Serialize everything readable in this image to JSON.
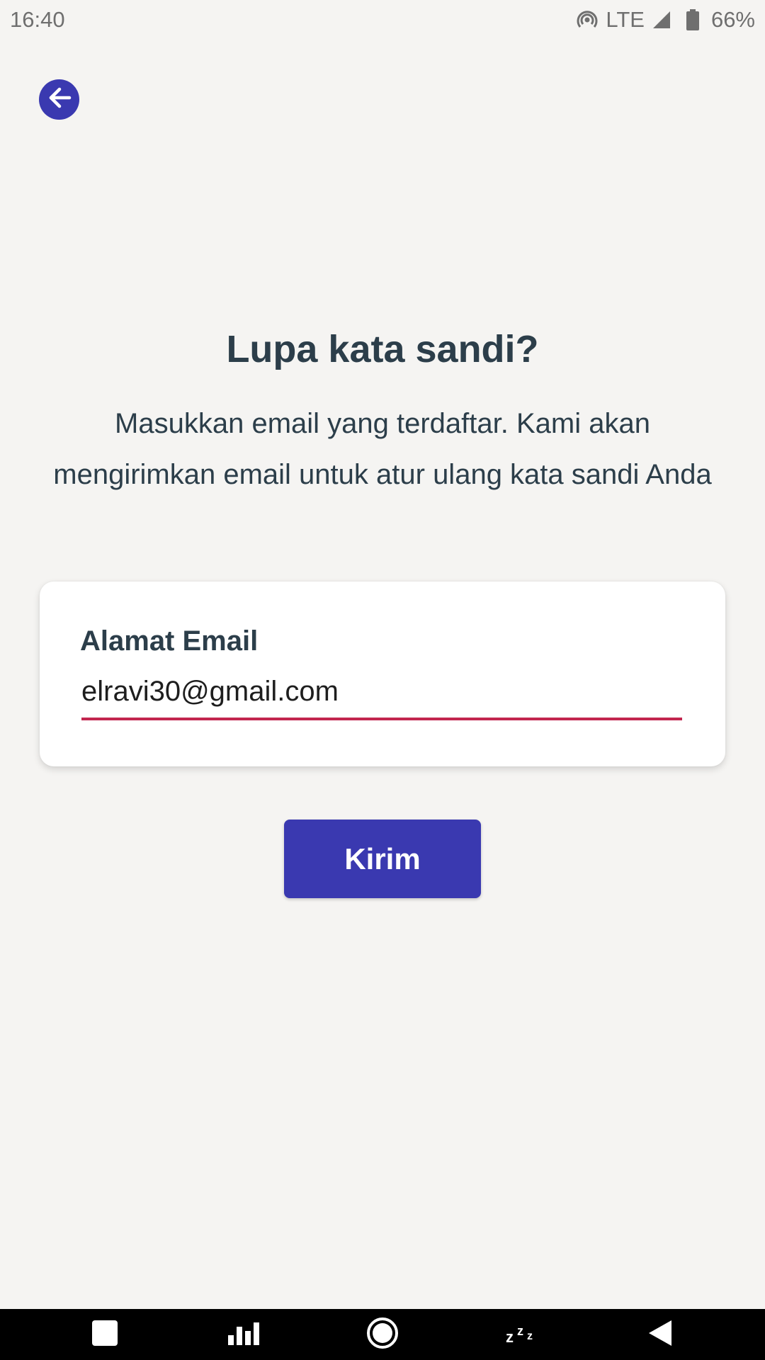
{
  "status_bar": {
    "time": "16:40",
    "network": "LTE",
    "battery": "66%",
    "icons": [
      "hotspot-icon",
      "signal-icon",
      "battery-icon"
    ]
  },
  "header": {
    "back_icon": "arrow-left-icon"
  },
  "main": {
    "title": "Lupa kata sandi?",
    "subtitle": "Masukkan email yang terdaftar. Kami akan mengirimkan email untuk atur ulang kata sandi Anda",
    "email_label": "Alamat Email",
    "email_value": "elravi30@gmail.com",
    "submit_label": "Kirim"
  },
  "nav_bar": {
    "items": [
      "square-icon",
      "bar-chart-icon",
      "home-circle-icon",
      "sleep-icon",
      "back-triangle-icon"
    ]
  },
  "colors": {
    "background": "#f5f4f2",
    "primary": "#3a39b0",
    "text": "#2c3e4a",
    "input_underline": "#c2264f"
  }
}
